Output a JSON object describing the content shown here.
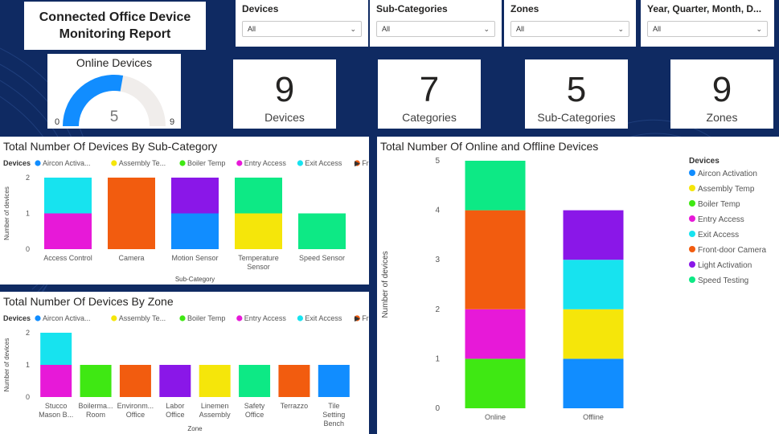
{
  "report_title": "Connected Office Device Monitoring Report",
  "slicers": [
    {
      "label": "Devices",
      "value": "All"
    },
    {
      "label": "Sub-Categories",
      "value": "All"
    },
    {
      "label": "Zones",
      "value": "All"
    },
    {
      "label": "Year, Quarter, Month, D...",
      "value": "All"
    }
  ],
  "kpis": [
    {
      "value": "9",
      "label": "Devices"
    },
    {
      "value": "7",
      "label": "Categories"
    },
    {
      "value": "5",
      "label": "Sub-Categories"
    },
    {
      "value": "9",
      "label": "Zones"
    }
  ],
  "gauge": {
    "title": "Online Devices",
    "value": 5,
    "min": 0,
    "max": 9,
    "value_label": "5",
    "min_label": "0",
    "max_label": "9",
    "fill_color": "#118dff",
    "track_color": "#f0edeb"
  },
  "legend_title": "Devices",
  "device_colors": {
    "Aircon Activation": "#118dff",
    "Assembly Temp": "#f5e60a",
    "Boiler Temp": "#3fe813",
    "Entry Access": "#e719d8",
    "Exit Access": "#17e3ef",
    "Front-door Camera": "#f25c0f",
    "Light Activation": "#8a17e8",
    "Speed Testing": "#0de985"
  },
  "chart_data": [
    {
      "type": "bar",
      "stacked": true,
      "title": "Total Number Of Devices By Sub-Category",
      "xlabel": "Sub-Category",
      "ylabel": "Number of devices",
      "ylim": [
        0,
        2
      ],
      "yticks": [
        "0",
        "1",
        "2"
      ],
      "legend_items": [
        "Aircon Activa...",
        "Assembly Te...",
        "Boiler Temp",
        "Entry Access",
        "Exit Access",
        "Front-door ..."
      ],
      "categories": [
        "Access Control",
        "Camera",
        "Motion Sensor",
        "Temperature Sensor",
        "Speed Sensor"
      ],
      "series": [
        {
          "name": "Aircon Activation",
          "values": [
            0,
            0,
            1,
            0,
            0
          ]
        },
        {
          "name": "Assembly Temp",
          "values": [
            0,
            0,
            0,
            1,
            0
          ]
        },
        {
          "name": "Entry Access",
          "values": [
            1,
            0,
            0,
            0,
            0
          ]
        },
        {
          "name": "Exit Access",
          "values": [
            1,
            0,
            0,
            0,
            0
          ]
        },
        {
          "name": "Front-door Camera",
          "values": [
            0,
            2,
            0,
            0,
            0
          ]
        },
        {
          "name": "Light Activation",
          "values": [
            0,
            0,
            1,
            0,
            0
          ]
        },
        {
          "name": "Speed Testing",
          "values": [
            0,
            0,
            0,
            1,
            1
          ]
        }
      ]
    },
    {
      "type": "bar",
      "stacked": true,
      "title": "Total Number Of Devices By Zone",
      "xlabel": "Zone",
      "ylabel": "Number of devices",
      "ylim": [
        0,
        2
      ],
      "yticks": [
        "0",
        "1",
        "2"
      ],
      "legend_items": [
        "Aircon Activa...",
        "Assembly Te...",
        "Boiler Temp",
        "Entry Access",
        "Exit Access",
        "Front-door ..."
      ],
      "categories": [
        "Stucco Mason B...",
        "Boilerma... Room",
        "Environm... Office",
        "Labor Office",
        "Linemen Assembly",
        "Safety Office",
        "Terrazzo",
        "Tile Setting Bench"
      ],
      "series": [
        {
          "name": "Aircon Activation",
          "values": [
            0,
            0,
            0,
            0,
            0,
            0,
            0,
            1
          ]
        },
        {
          "name": "Assembly Temp",
          "values": [
            0,
            0,
            0,
            0,
            1,
            0,
            0,
            0
          ]
        },
        {
          "name": "Boiler Temp",
          "values": [
            0,
            1,
            0,
            0,
            0,
            0,
            0,
            0
          ]
        },
        {
          "name": "Entry Access",
          "values": [
            1,
            0,
            0,
            0,
            0,
            0,
            0,
            0
          ]
        },
        {
          "name": "Exit Access",
          "values": [
            1,
            0,
            0,
            0,
            0,
            0,
            0,
            0
          ]
        },
        {
          "name": "Front-door Camera",
          "values": [
            0,
            0,
            1,
            0,
            0,
            0,
            1,
            0
          ]
        },
        {
          "name": "Light Activation",
          "values": [
            0,
            0,
            0,
            1,
            0,
            0,
            0,
            0
          ]
        },
        {
          "name": "Speed Testing",
          "values": [
            0,
            0,
            0,
            0,
            0,
            1,
            0,
            0
          ]
        }
      ]
    },
    {
      "type": "bar",
      "stacked": true,
      "title": "Total Number Of Online and Offline Devices",
      "xlabel": "",
      "ylabel": "Number of devices",
      "ylim": [
        0,
        5
      ],
      "yticks": [
        "0",
        "1",
        "2",
        "3",
        "4",
        "5"
      ],
      "legend_items": [
        "Aircon Activation",
        "Assembly Temp",
        "Boiler Temp",
        "Entry Access",
        "Exit Access",
        "Front-door Camera",
        "Light Activation",
        "Speed Testing"
      ],
      "categories": [
        "Online",
        "Offline"
      ],
      "series": [
        {
          "name": "Aircon Activation",
          "values": [
            0,
            1
          ]
        },
        {
          "name": "Assembly Temp",
          "values": [
            0,
            1
          ]
        },
        {
          "name": "Boiler Temp",
          "values": [
            1,
            0
          ]
        },
        {
          "name": "Entry Access",
          "values": [
            1,
            0
          ]
        },
        {
          "name": "Exit Access",
          "values": [
            0,
            1
          ]
        },
        {
          "name": "Front-door Camera",
          "values": [
            2,
            0
          ]
        },
        {
          "name": "Light Activation",
          "values": [
            0,
            1
          ]
        },
        {
          "name": "Speed Testing",
          "values": [
            1,
            0
          ]
        }
      ]
    }
  ]
}
